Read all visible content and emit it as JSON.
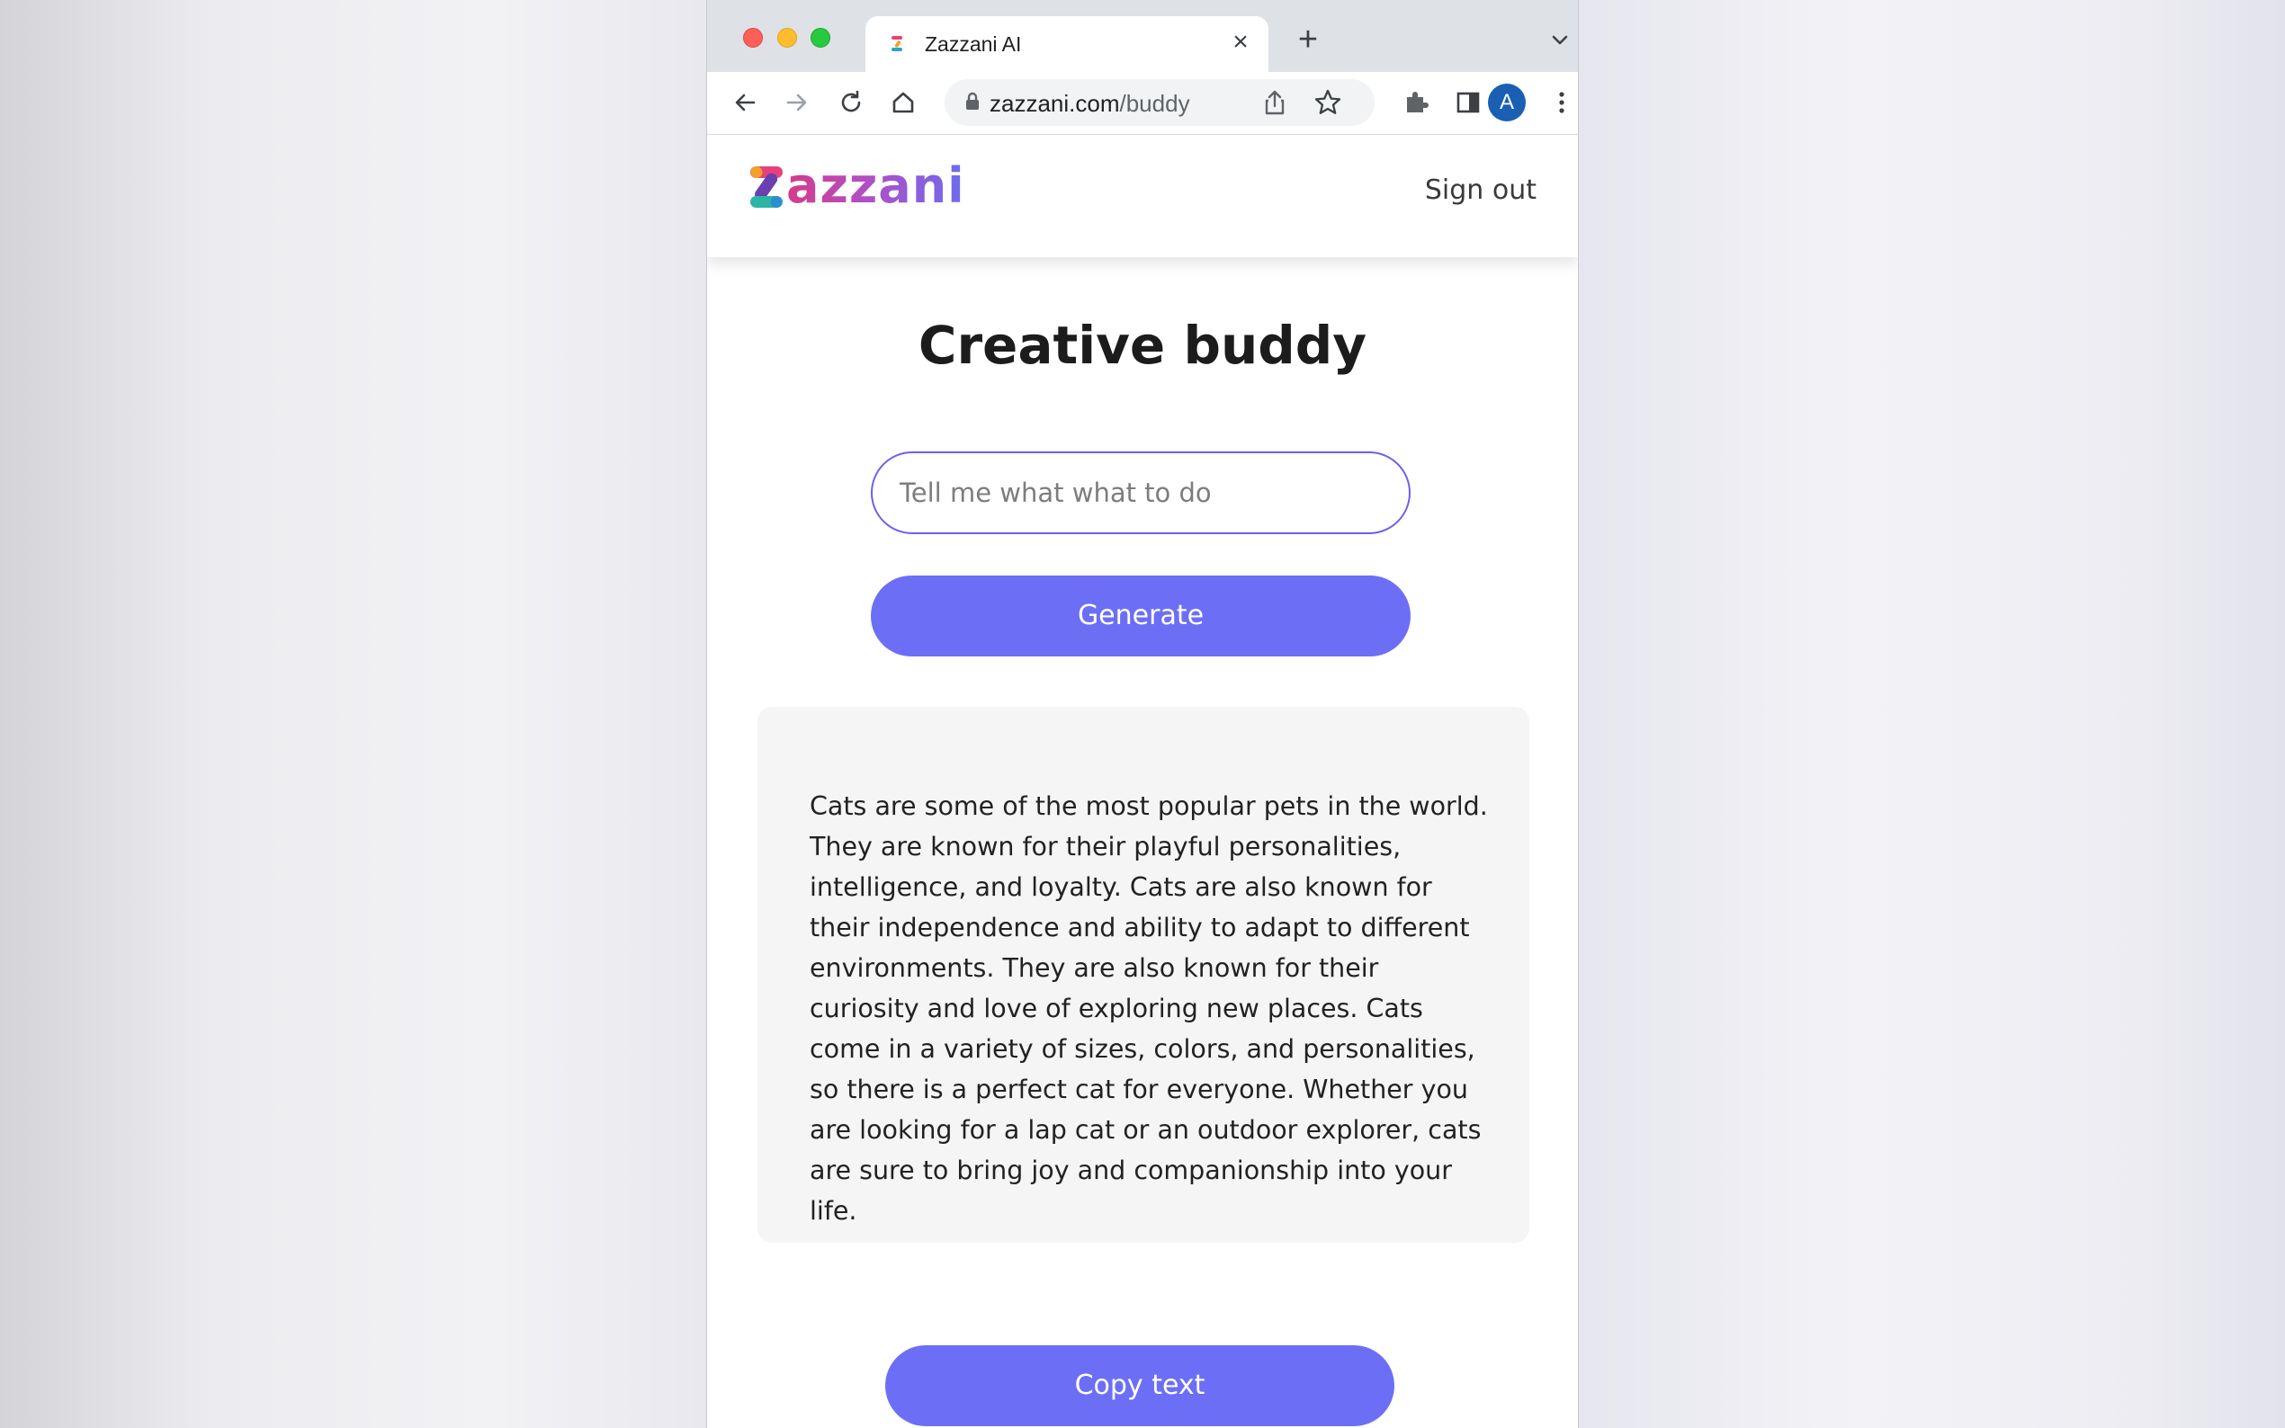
{
  "browser": {
    "tab_title": "Zazzani AI",
    "url_domain": "zazzani.com",
    "url_path": "/buddy",
    "profile_initial": "A"
  },
  "header": {
    "logo_text": "azzani",
    "sign_out_label": "Sign out"
  },
  "main": {
    "title": "Creative buddy",
    "prompt_placeholder": "Tell me what what to do",
    "prompt_value": "",
    "generate_label": "Generate",
    "result_text": "Cats are some of the most popular pets in the world. They are known for their playful personalities, intelligence, and loyalty. Cats are also known for their independence and ability to adapt to different environments. They are also known for their curiosity and love of exploring new places. Cats come in a variety of sizes, colors, and personalities, so there is a perfect cat for everyone. Whether you are looking for a lap cat or an outdoor explorer, cats are sure to bring joy and companionship into your life.",
    "copy_label": "Copy text"
  },
  "colors": {
    "accent": "#6c6ff5",
    "input_border": "#6c5ff0",
    "logo_pink": "#d63a8c",
    "logo_blue": "#6b6cf0"
  },
  "icons": [
    "close-icon",
    "plus-icon",
    "chevron-down-icon",
    "back-arrow-icon",
    "forward-arrow-icon",
    "reload-icon",
    "home-icon",
    "lock-icon",
    "share-icon",
    "star-icon",
    "extensions-puzzle-icon",
    "side-panel-icon",
    "more-vertical-icon"
  ]
}
